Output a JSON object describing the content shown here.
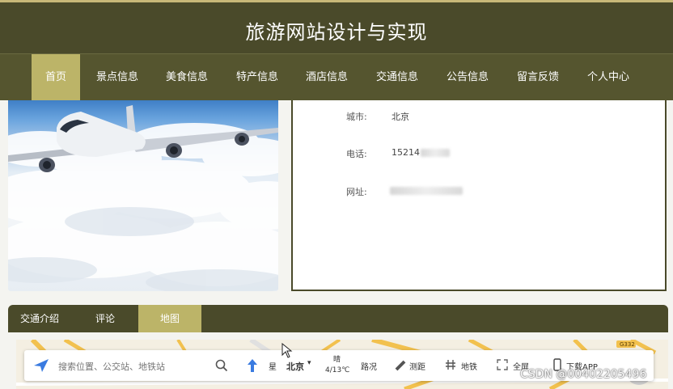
{
  "site": {
    "title": "旅游网站设计与实现"
  },
  "nav": {
    "items": [
      {
        "label": "首页",
        "active": true
      },
      {
        "label": "景点信息"
      },
      {
        "label": "美食信息"
      },
      {
        "label": "特产信息"
      },
      {
        "label": "酒店信息"
      },
      {
        "label": "交通信息"
      },
      {
        "label": "公告信息"
      },
      {
        "label": "留言反馈"
      },
      {
        "label": "个人中心"
      }
    ]
  },
  "info": {
    "city_label": "城市:",
    "city_value": "北京",
    "phone_label": "电话:",
    "phone_value": "15214",
    "website_label": "网址:"
  },
  "tabs": {
    "items": [
      {
        "label": "交通介绍"
      },
      {
        "label": "评论"
      },
      {
        "label": "地图",
        "active": true
      }
    ]
  },
  "map_toolbar": {
    "search_placeholder": "搜索位置、公交站、地铁站",
    "city": "北京",
    "weather_label": "晴",
    "temperature": "4/13℃",
    "star_label": "星",
    "traffic": "路况",
    "measure": "测距",
    "subway": "地铁",
    "fullscreen": "全屏",
    "download": "下载APP",
    "road_label": "G332"
  },
  "watermark": "CSDN @00402205496",
  "colors": {
    "header": "#4a4a2a",
    "nav": "#55552f",
    "accent": "#bcb468"
  }
}
